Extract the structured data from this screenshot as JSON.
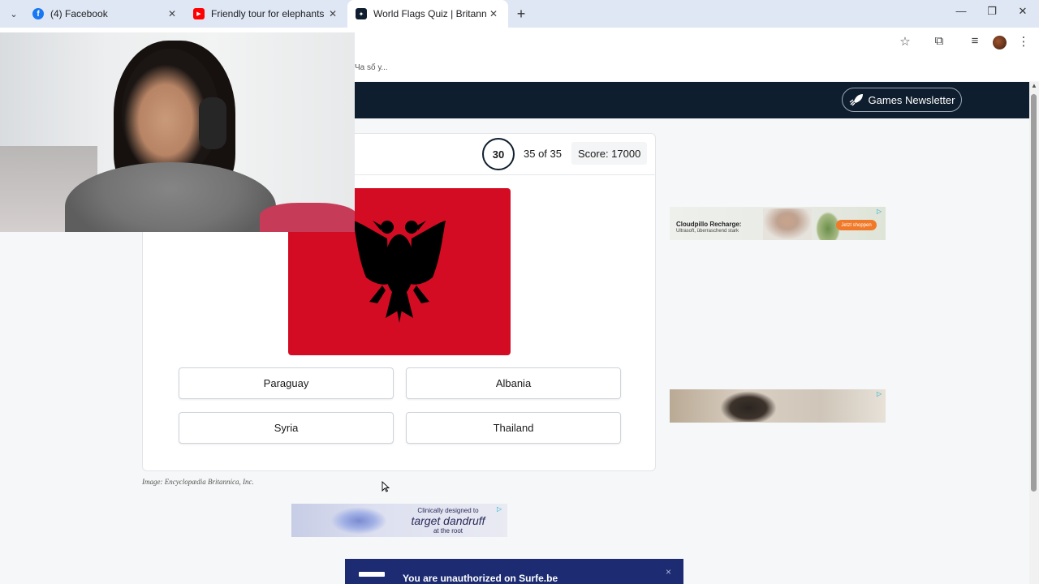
{
  "browser": {
    "tabs": [
      {
        "title": "(4) Facebook",
        "favicon": "facebook-icon",
        "color": "#1877f2"
      },
      {
        "title": "Friendly tour for elephants in D",
        "favicon": "youtube-icon",
        "color": "#ff0000"
      },
      {
        "title": "World Flags Quiz | Britannica",
        "favicon": "britannica-icon",
        "color": "#0f1e2e"
      }
    ],
    "bookmark_fragment": "Ча số у..."
  },
  "header": {
    "newsletter_label": "Games Newsletter"
  },
  "quiz": {
    "timer": "30",
    "progress": "35 of 35",
    "score_label": "Score: 17000",
    "answers": [
      "Paraguay",
      "Albania",
      "Syria",
      "Thailand"
    ],
    "image_credit": "Image: Encyclopædia Britannica, Inc.",
    "flag_colors": {
      "field": "#d40c23",
      "eagle": "#000000"
    }
  },
  "ads": {
    "ad1_title": "Cloudpillo Recharge:",
    "ad1_sub": "Ultrasoft, überraschend stark",
    "ad1_cta": "Jetzt shoppen",
    "ad3_line1": "Clinically designed to",
    "ad3_line2": "target dandruff",
    "ad3_line3": "at the root"
  },
  "popup": {
    "text": "You are unauthorized on Surfe.be",
    "close": "×"
  },
  "colors": {
    "header_bg": "#0f1e2e",
    "tabbar_bg": "#dfe7f5",
    "popup_bg": "#1d2c72"
  }
}
